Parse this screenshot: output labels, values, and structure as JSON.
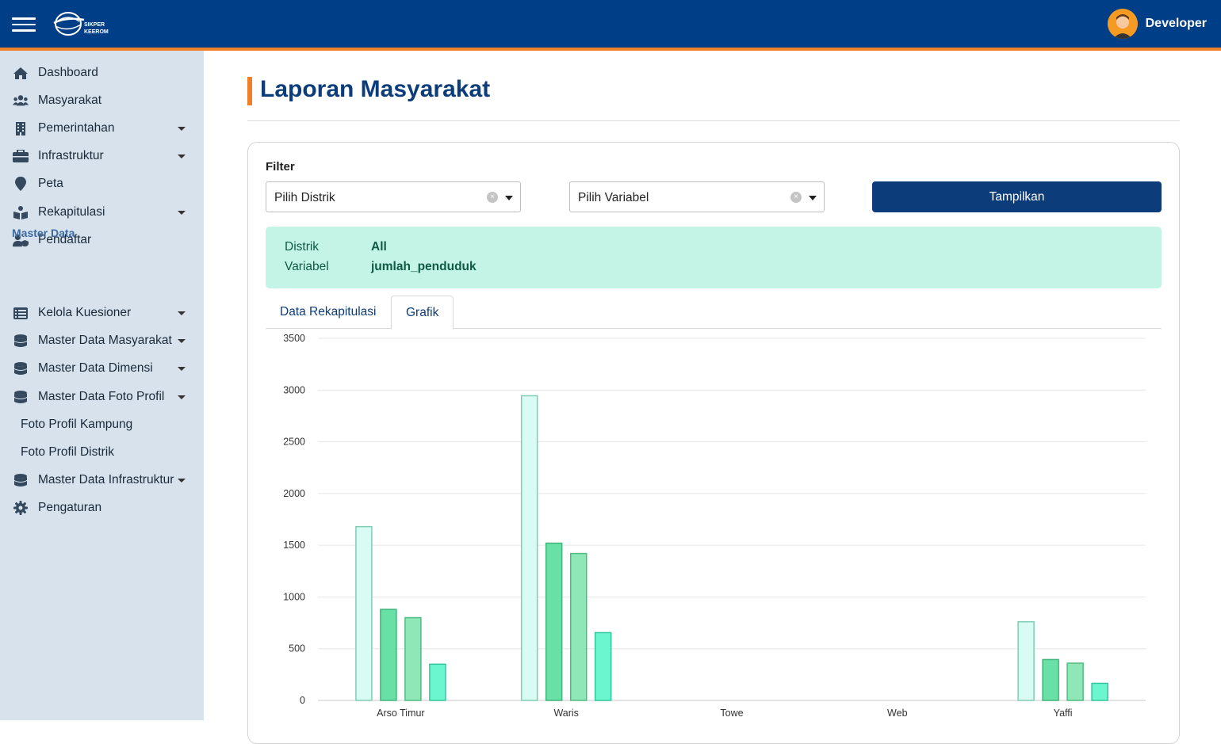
{
  "header": {
    "logo_text_top": "SIKPER",
    "logo_text_bottom": "KEEROM",
    "user_name": "Developer"
  },
  "sidebar": {
    "items": [
      {
        "label": "Dashboard",
        "icon": "home-icon",
        "caret": false
      },
      {
        "label": "Masyarakat",
        "icon": "users-icon",
        "caret": false
      },
      {
        "label": "Pemerintahan",
        "icon": "building-icon",
        "caret": true
      },
      {
        "label": "Infrastruktur",
        "icon": "briefcase-icon",
        "caret": true
      },
      {
        "label": "Peta",
        "icon": "map-marker-icon",
        "caret": false
      },
      {
        "label": "Rekapitulasi",
        "icon": "reading-icon",
        "caret": true
      },
      {
        "label": "Pendaftar",
        "icon": "user-shield-icon",
        "caret": false
      }
    ],
    "master_heading": "Master Data",
    "master_items": [
      {
        "label": "Kelola Kuesioner",
        "icon": "list-icon",
        "caret": true
      },
      {
        "label": "Master Data Masyarakat",
        "icon": "database-icon",
        "caret": true
      },
      {
        "label": "Master Data Dimensi",
        "icon": "database-icon",
        "caret": true
      },
      {
        "label": "Master Data Foto Profil",
        "icon": "database-icon",
        "caret": true
      },
      {
        "label": "Foto Profil Kampung",
        "sub": true
      },
      {
        "label": "Foto Profil Distrik",
        "sub": true
      },
      {
        "label": "Master Data Infrastruktur",
        "icon": "database-icon",
        "caret": true
      },
      {
        "label": "Pengaturan",
        "icon": "gear-icon",
        "caret": false
      }
    ]
  },
  "main": {
    "title": "Laporan Masyarakat",
    "filter_label": "Filter",
    "distrik_placeholder": "Pilih Distrik",
    "variabel_placeholder": "Pilih Variabel",
    "submit_label": "Tampilkan",
    "info": {
      "distrik_key": "Distrik",
      "distrik_value": "All",
      "variabel_key": "Variabel",
      "variabel_value": "jumlah_penduduk"
    },
    "tabs": [
      "Data Rekapitulasi",
      "Grafik"
    ],
    "active_tab": "Grafik"
  },
  "colors": {
    "topbar": "#003f88",
    "accent": "#f07f2a",
    "sidebar": "#d7e2ec",
    "primary": "#0c3c7a",
    "info_bg": "#c4f4e6"
  },
  "chart_data": {
    "type": "bar",
    "categories": [
      "Arso Timur",
      "Waris",
      "Towe",
      "Web",
      "Yaffi"
    ],
    "series": [
      {
        "values": [
          1680,
          2945,
          0,
          0,
          760
        ],
        "color": "#d8fbf3",
        "stroke": "#7fcdb2"
      },
      {
        "values": [
          880,
          1520,
          0,
          0,
          395
        ],
        "color": "#69e0a6",
        "stroke": "#3fb67c"
      },
      {
        "values": [
          800,
          1420,
          0,
          0,
          360
        ],
        "color": "#8fe6b6",
        "stroke": "#4fbb82"
      },
      {
        "values": [
          350,
          655,
          0,
          0,
          165
        ],
        "color": "#6cf6d0",
        "stroke": "#33c79d"
      }
    ],
    "yticks": [
      0,
      500,
      1000,
      1500,
      2000,
      2500,
      3000,
      3500
    ],
    "ylim": [
      0,
      3500
    ],
    "grid": true
  }
}
